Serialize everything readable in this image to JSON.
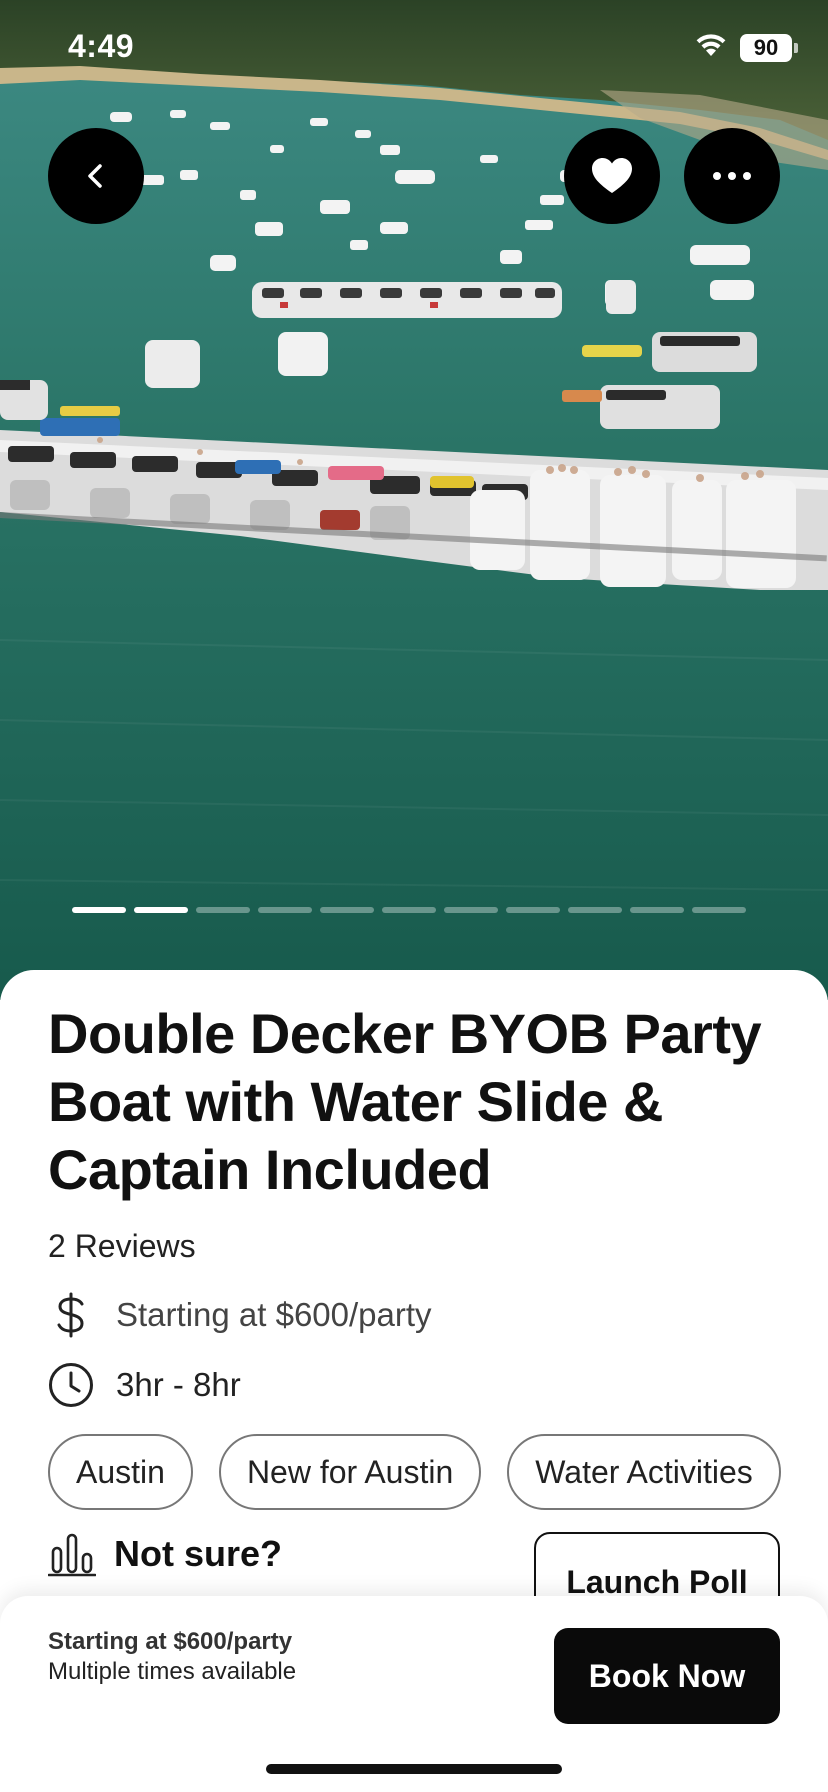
{
  "status_bar": {
    "time": "4:49",
    "battery": "90"
  },
  "hero": {
    "photo_count": 11,
    "active_index": 1
  },
  "listing": {
    "title": "Double Decker BYOB Party Boat with Water Slide & Captain Included",
    "reviews": "2 Reviews",
    "price": "Starting at $600/party",
    "duration": "3hr - 8hr",
    "tags": [
      "Austin",
      "New for Austin",
      "Water Activities"
    ]
  },
  "poll": {
    "title": "Not sure?",
    "button_label": "Launch Poll"
  },
  "bottom_bar": {
    "price": "Starting at $600/party",
    "subtitle": "Multiple times available",
    "book_label": "Book Now"
  },
  "icons": {
    "back": "chevron-left-icon",
    "favorite": "heart-icon",
    "more": "more-horizontal-icon",
    "price": "dollar-icon",
    "duration": "clock-icon",
    "poll": "bar-chart-icon",
    "wifi": "wifi-icon",
    "battery": "battery-icon"
  },
  "colors": {
    "button_black": "#0a0a0a",
    "water": "#1f6a5e",
    "text": "#111111"
  }
}
